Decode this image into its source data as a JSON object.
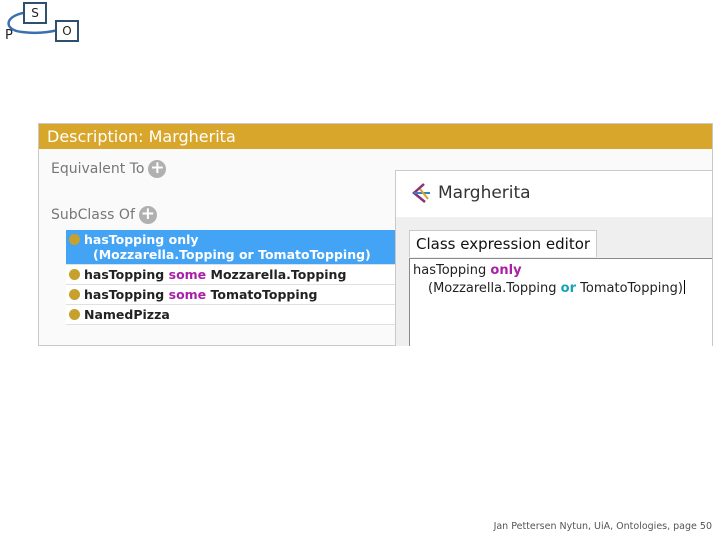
{
  "logo": {
    "s": "S",
    "o": "O",
    "p": "P"
  },
  "panel": {
    "header": "Description: Margherita",
    "equivalent_label": "Equivalent To",
    "subclass_label": "SubClass Of",
    "plus_glyph": "+",
    "rows": [
      {
        "line1_prop": "hasTopping",
        "line1_kw": "only",
        "line2_open": "(Mozzarella.Topping",
        "line2_or": "or",
        "line2_close": "TomatoTopping)",
        "selected": true
      },
      {
        "prop": "hasTopping",
        "kw": "some",
        "filler": "Mozzarella.Topping"
      },
      {
        "prop": "hasTopping",
        "kw": "some",
        "filler": "TomatoTopping"
      },
      {
        "prop": "NamedPizza"
      }
    ]
  },
  "editor": {
    "title": "Margherita",
    "tab": "Class expression editor",
    "line1_prop": "hasTopping",
    "line1_kw": "only",
    "line2_open": "(Mozzarella.Topping",
    "line2_or": "or",
    "line2_close": "TomatoTopping)"
  },
  "footer": "Jan Pettersen Nytun, UiA, Ontologies, page 50",
  "colors": {
    "header": "#d9a62c",
    "selection": "#43a3f5",
    "keyword": "#aa1ea8",
    "or_keyword": "#16a3b8",
    "dot": "#c8a02c"
  }
}
